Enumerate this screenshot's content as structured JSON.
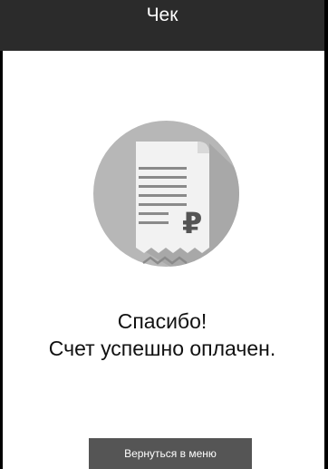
{
  "header": {
    "title": "Чек"
  },
  "receipt_icon": {
    "name": "receipt-ruble-icon",
    "symbol": "₽"
  },
  "message": {
    "line1": "Спасибо!",
    "line2": "Счет успешно оплачен."
  },
  "actions": {
    "back_to_menu_label": "Вернуться в меню"
  },
  "colors": {
    "header_bg": "#2b2b2b",
    "circle": "#b7b7b7",
    "paper": "#f2f2f2",
    "button_bg": "#555555"
  }
}
